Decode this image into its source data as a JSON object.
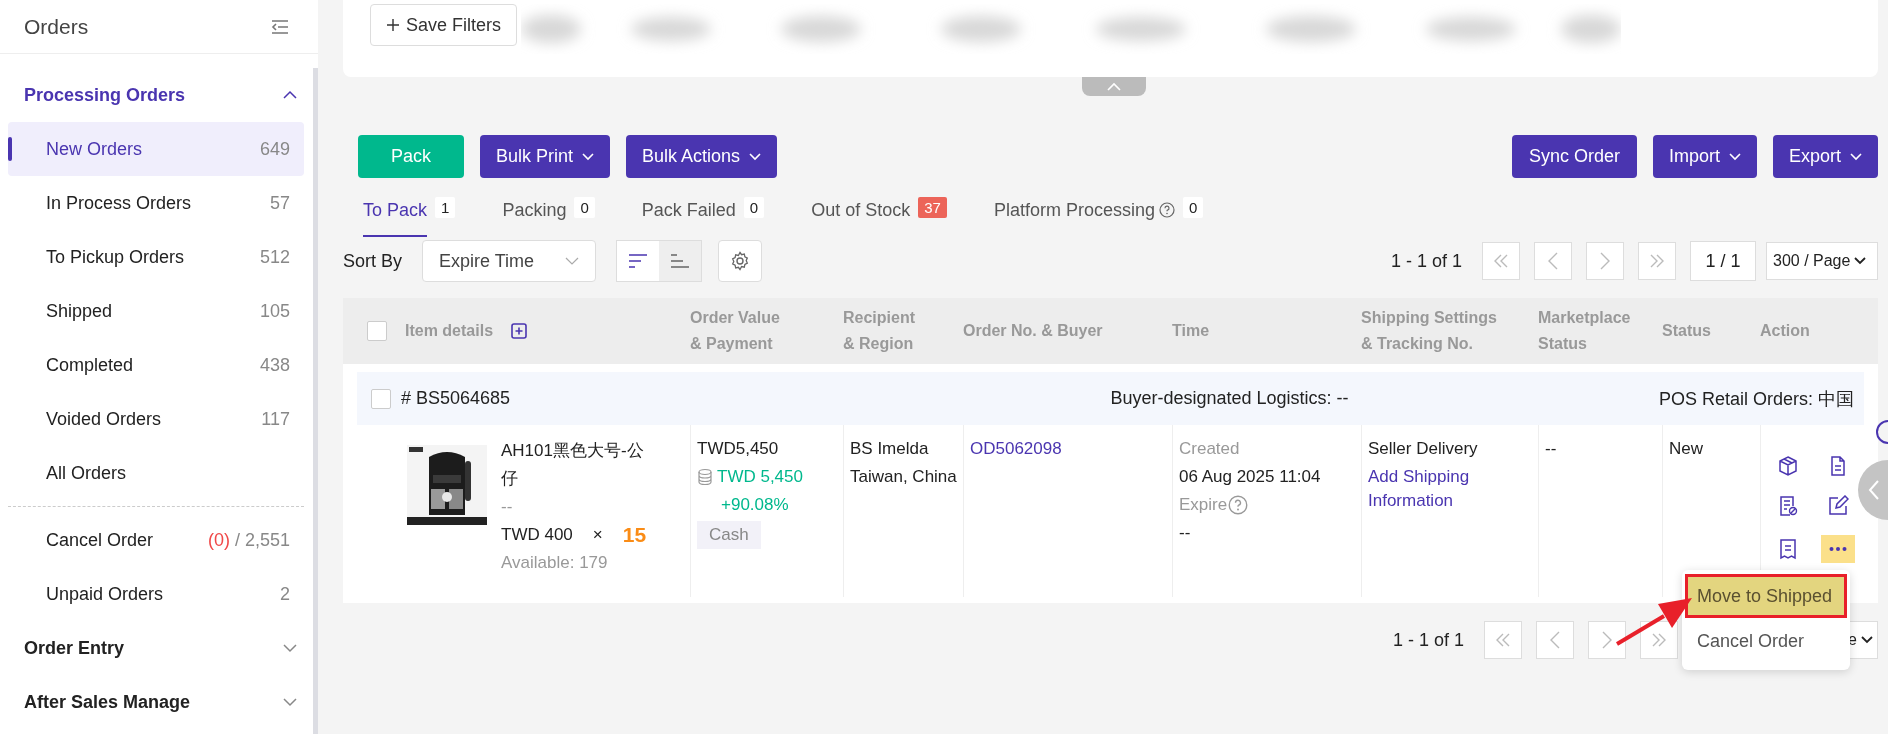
{
  "sidebar": {
    "title": "Orders",
    "groups": [
      {
        "label": "Processing Orders",
        "expanded": true,
        "items": [
          {
            "label": "New Orders",
            "count": "649",
            "selected": true
          },
          {
            "label": "In Process Orders",
            "count": "57",
            "selected": false
          },
          {
            "label": "To Pickup Orders",
            "count": "512",
            "selected": false
          },
          {
            "label": "Shipped",
            "count": "105",
            "selected": false
          },
          {
            "label": "Completed",
            "count": "438",
            "selected": false
          },
          {
            "label": "Voided Orders",
            "count": "117",
            "selected": false
          },
          {
            "label": "All Orders",
            "selected": false
          }
        ],
        "more_items": [
          {
            "label": "Cancel Order",
            "alert_count": "(0)",
            "count": "/ 2,551",
            "selected": false
          },
          {
            "label": "Unpaid Orders",
            "count": "2",
            "selected": false
          }
        ]
      },
      {
        "label": "Order Entry",
        "expanded": false
      },
      {
        "label": "After Sales Manage",
        "expanded": false
      }
    ]
  },
  "filters": {
    "save_button": "Save Filters"
  },
  "actions_left": [
    {
      "label": "Pack",
      "kind": "success"
    },
    {
      "label": "Bulk Print",
      "kind": "dropdown"
    },
    {
      "label": "Bulk Actions",
      "kind": "dropdown"
    }
  ],
  "actions_right": [
    {
      "label": "Sync Order",
      "kind": "plain"
    },
    {
      "label": "Import",
      "kind": "dropdown"
    },
    {
      "label": "Export",
      "kind": "dropdown"
    }
  ],
  "tabs": [
    {
      "label": "To Pack",
      "count": "1",
      "selected": true,
      "alert": false,
      "help": false
    },
    {
      "label": "Packing",
      "count": "0",
      "selected": false,
      "alert": false,
      "help": false
    },
    {
      "label": "Pack Failed",
      "count": "0",
      "selected": false,
      "alert": false,
      "help": false
    },
    {
      "label": "Out of Stock",
      "count": "37",
      "selected": false,
      "alert": true,
      "help": false
    },
    {
      "label": "Platform Processing",
      "count": "0",
      "selected": false,
      "alert": false,
      "help": true
    }
  ],
  "sort": {
    "label": "Sort By",
    "value": "Expire Time",
    "directions": [
      {
        "selected": true
      },
      {
        "selected": false
      }
    ]
  },
  "pagination": {
    "range": "1 - 1 of 1",
    "page": "1 / 1",
    "page_size": "300 / Page"
  },
  "table": {
    "select_all_checked": false,
    "columns": [
      "Item details",
      "Order Value\n& Payment",
      "Recipient\n& Region",
      "Order No. & Buyer",
      "Time",
      "Shipping Settings\n& Tracking No.",
      "Marketplace\nStatus",
      "Status",
      "Action"
    ],
    "groups": [
      {
        "checked": false,
        "order_id": "# BS5064685",
        "logistics": "Buyer-designated Logistics: --",
        "source": "POS Retail Orders: 中国",
        "item": {
          "name": "AH101黑色大号-公仔",
          "variant": "--",
          "price": "TWD 400",
          "times": "×",
          "qty": "15",
          "available": "Available: 179",
          "value": "TWD5,450",
          "paid": "TWD 5,450",
          "margin": "+90.08%",
          "method": "Cash",
          "recipient": "BS Imelda",
          "region": "Taiwan, China",
          "order_no": "OD5062098",
          "created_label": "Created",
          "created": "06 Aug 2025 11:04",
          "expire_label": "Expire",
          "expire": "--",
          "shipping": "Seller Delivery",
          "shipping_link": "Add Shipping Information",
          "marketplace": "--",
          "status": "New",
          "actions": [
            {
              "kind": "box"
            },
            {
              "kind": "doc"
            },
            {
              "kind": "doc-check"
            },
            {
              "kind": "edit"
            },
            {
              "kind": "receipt"
            },
            {
              "kind": "more",
              "selected": true
            }
          ]
        }
      }
    ]
  },
  "menu": {
    "items": [
      {
        "label": "Move to Shipped",
        "selected": true
      },
      {
        "label": "Cancel Order",
        "selected": false
      }
    ]
  },
  "bottom_pagination": {
    "range": "1 - 1 of 1",
    "page_size_visible": "e"
  }
}
